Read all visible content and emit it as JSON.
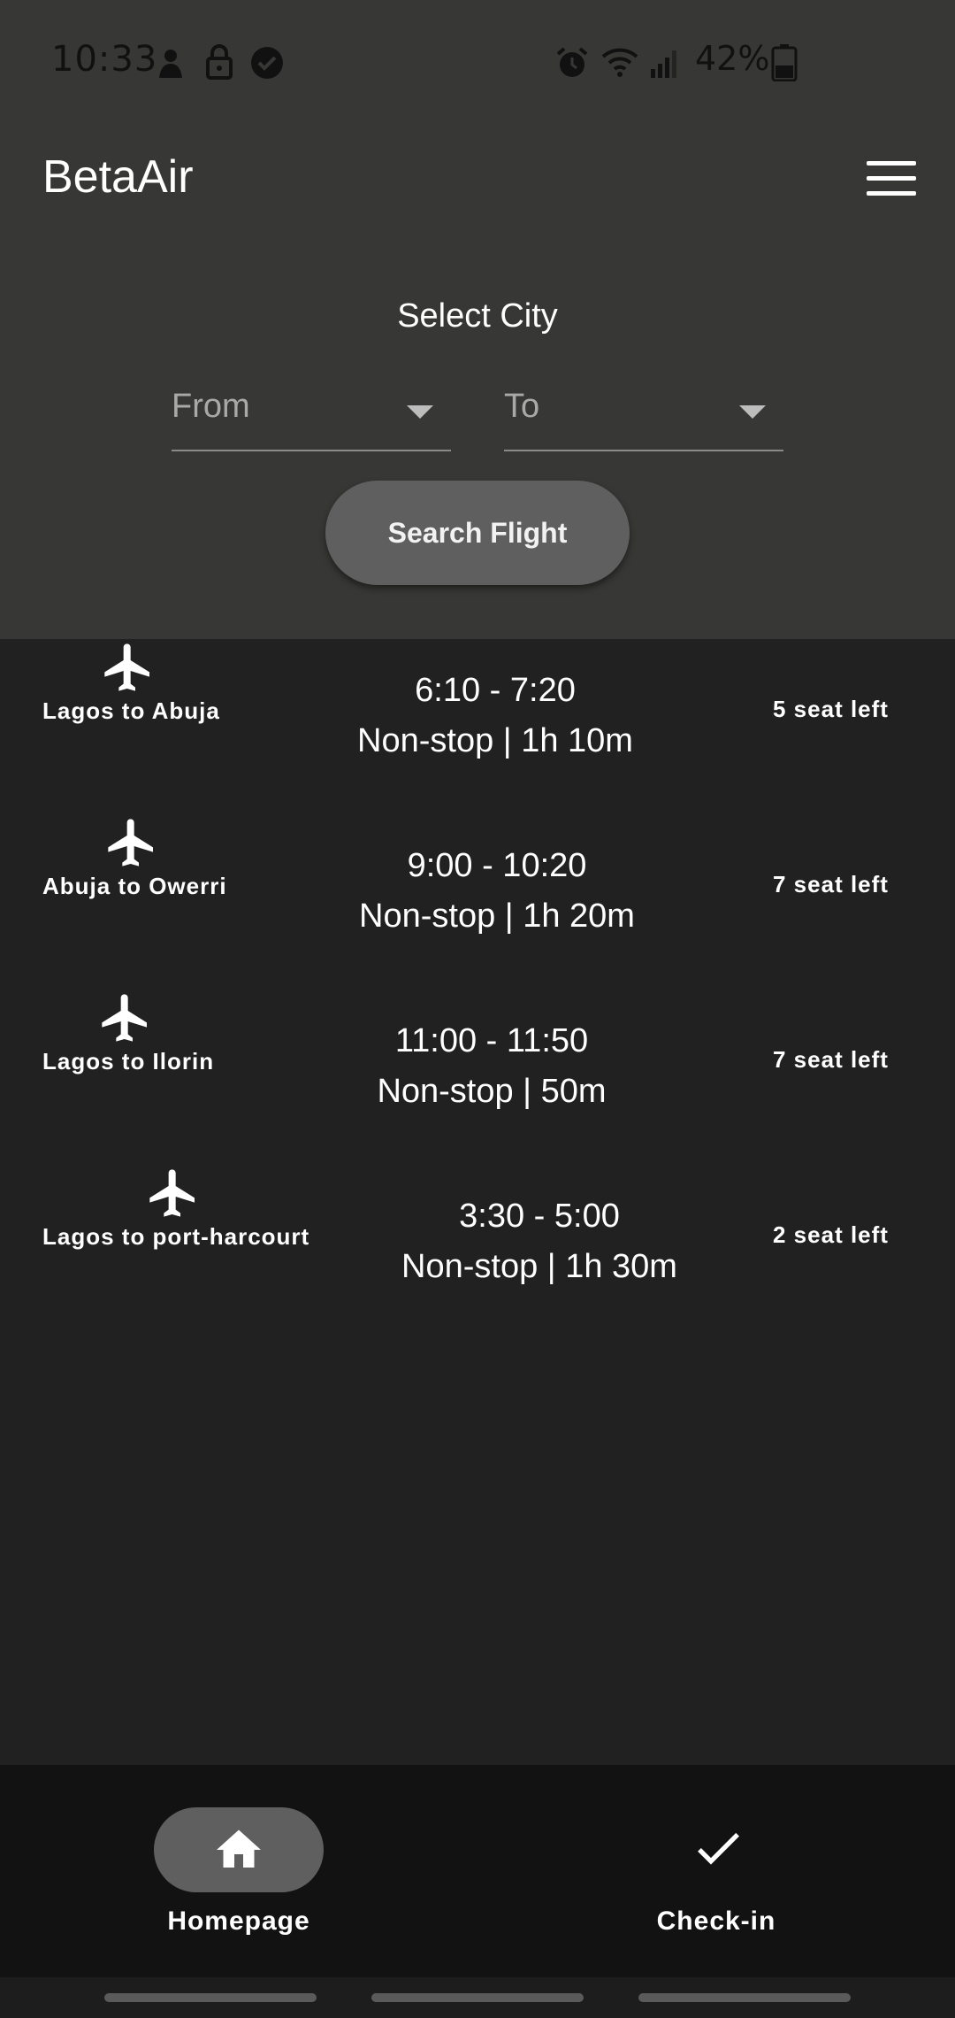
{
  "status_bar": {
    "time": "10:33",
    "battery": "42%",
    "icons_left": [
      "notification-person-icon",
      "lock-icon",
      "check-circle-icon"
    ],
    "icons_right": [
      "alarm-icon",
      "wifi-icon",
      "signal-icon",
      "battery-icon"
    ]
  },
  "header": {
    "title": "BetaAir",
    "menu_icon": "hamburger-menu-icon"
  },
  "search": {
    "heading": "Select City",
    "from_label": "From",
    "to_label": "To",
    "button_label": "Search Flight"
  },
  "flights": [
    {
      "route": "Lagos to Abuja",
      "times": "6:10 - 7:20",
      "duration": "Non-stop | 1h 10m",
      "seats": "5 seat left"
    },
    {
      "route": "Abuja to Owerri",
      "times": "9:00 - 10:20",
      "duration": "Non-stop | 1h 20m",
      "seats": "7 seat left"
    },
    {
      "route": "Lagos to Ilorin",
      "times": "11:00 - 11:50",
      "duration": "Non-stop | 50m",
      "seats": "7 seat left"
    },
    {
      "route": "Lagos to port-harcourt",
      "times": "3:30 - 5:00",
      "duration": "Non-stop | 1h 30m",
      "seats": "2 seat left"
    }
  ],
  "bottom_nav": {
    "items": [
      {
        "label": "Homepage",
        "icon": "home-icon",
        "selected": true
      },
      {
        "label": "Check-in",
        "icon": "check-icon",
        "selected": false
      }
    ]
  },
  "colors": {
    "header_bg": "#373835",
    "list_bg": "#212121",
    "nav_bg": "#121212",
    "button_bg": "#5f5f5f"
  }
}
